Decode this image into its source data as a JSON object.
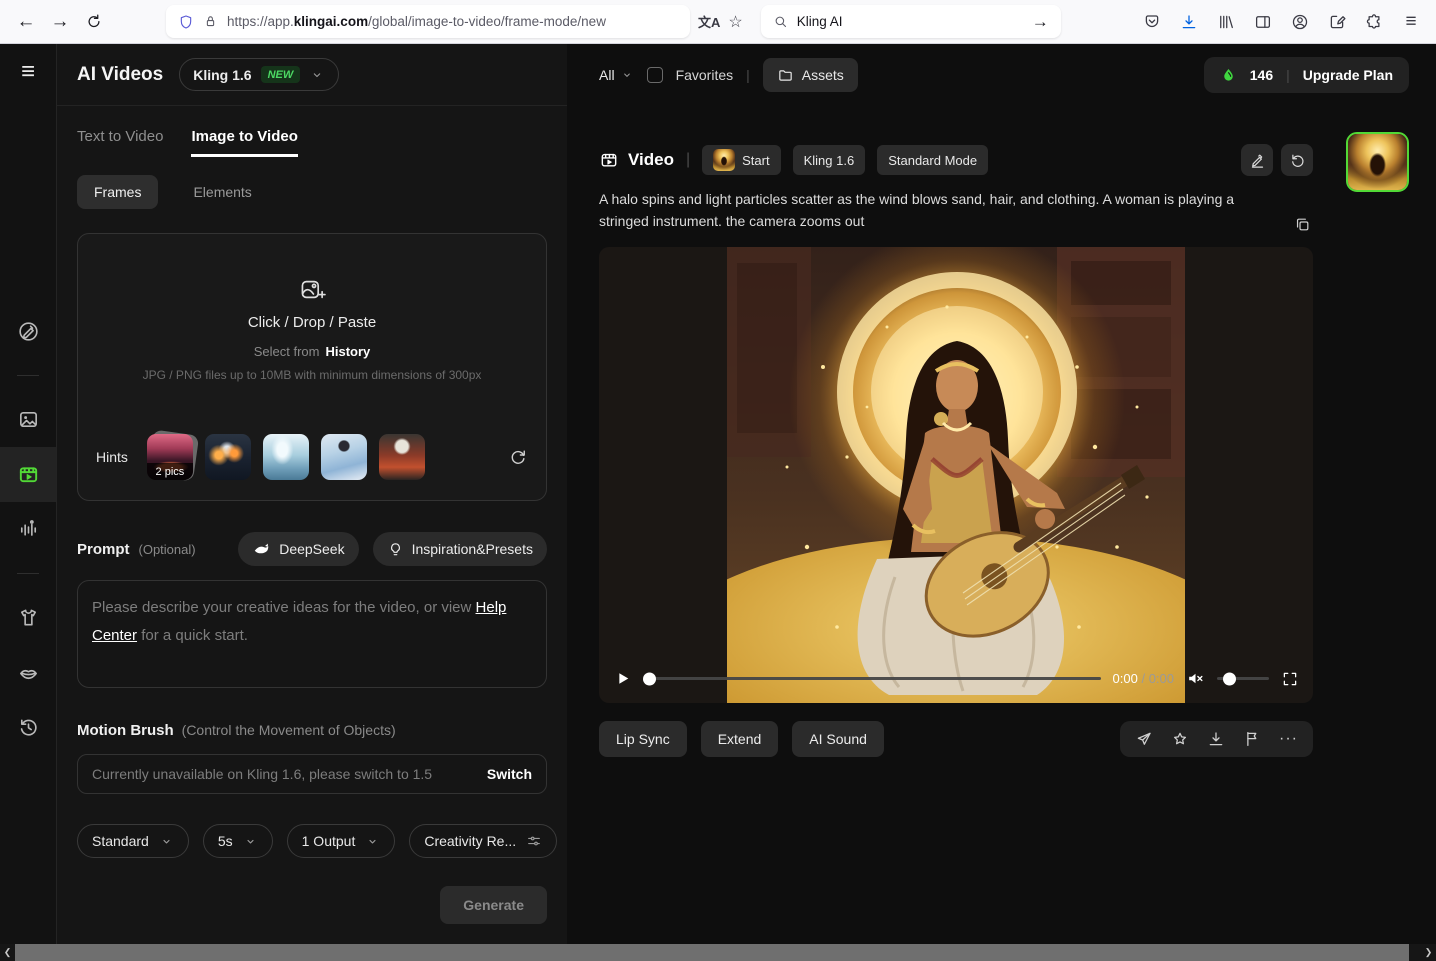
{
  "icons": {
    "back": "←",
    "forward": "→",
    "menu": "≡",
    "divider": "|",
    "translate": "文A",
    "bookmark_star": "☆",
    "go_arrow": "→",
    "ellipsis": "···",
    "scroll_left": "❮",
    "scroll_right": "❯",
    "slash": "/"
  },
  "browser": {
    "url_scheme": "https://app.",
    "url_domain": "klingai.com",
    "url_path": "/global/image-to-video/frame-mode/new",
    "search_value": "Kling AI"
  },
  "sidebar": {
    "title": "AI Videos",
    "model": {
      "name": "Kling 1.6",
      "badge": "NEW"
    },
    "tabs": [
      {
        "label": "Text to Video"
      },
      {
        "label": "Image to Video"
      }
    ],
    "modes": [
      {
        "label": "Frames"
      },
      {
        "label": "Elements"
      }
    ],
    "upload": {
      "title": "Click / Drop / Paste",
      "select_prefix": "Select from",
      "select_link": "History",
      "requirements": "JPG / PNG files up to 10MB with minimum dimensions of 300px"
    },
    "hints": {
      "label": "Hints",
      "badge": "2 pics"
    },
    "prompt": {
      "label": "Prompt",
      "optional": "(Optional)",
      "deepseek": "DeepSeek",
      "inspiration": "Inspiration&Presets",
      "placeholder_before": "Please describe your creative ideas for the video, or view ",
      "placeholder_link": "Help Center",
      "placeholder_after": " for a quick start."
    },
    "motion_brush": {
      "label": "Motion Brush",
      "hint": "(Control the Movement of Objects)",
      "message": "Currently unavailable on Kling 1.6, please switch to 1.5",
      "action": "Switch"
    },
    "settings": [
      {
        "label": "Standard"
      },
      {
        "label": "5s"
      },
      {
        "label": "1 Output"
      },
      {
        "label": "Creativity Re..."
      }
    ],
    "generate": "Generate"
  },
  "main": {
    "filter": {
      "all": "All",
      "favorites": "Favorites",
      "assets": "Assets"
    },
    "credits": {
      "count": "146",
      "upgrade": "Upgrade Plan"
    },
    "video": {
      "title": "Video",
      "start_tag": "Start",
      "model_tag": "Kling 1.6",
      "mode_tag": "Standard Mode",
      "prompt": "A halo spins and light particles scatter as the wind blows sand, hair, and clothing. A woman is playing a stringed instrument. the camera zooms out",
      "current_time": "0:00",
      "duration": "0:00",
      "actions": [
        {
          "label": "Lip Sync"
        },
        {
          "label": "Extend"
        },
        {
          "label": "AI Sound"
        }
      ]
    }
  },
  "colors": {
    "accent_green": "#52d936",
    "credits_green": "#3fd63f",
    "badge_green": "#4cd964"
  }
}
